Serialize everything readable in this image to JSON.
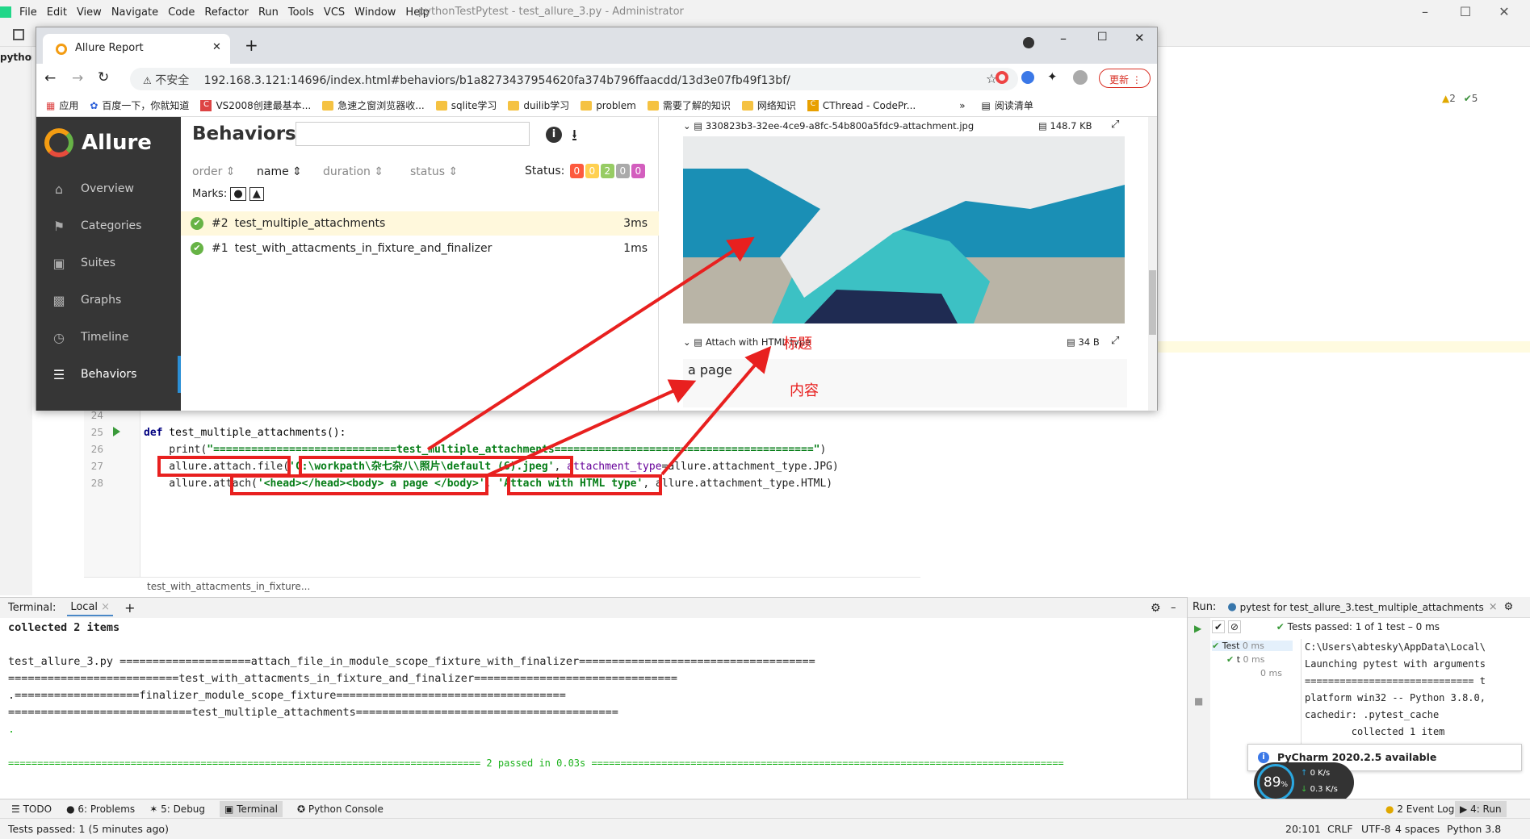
{
  "ide": {
    "menus": [
      "File",
      "Edit",
      "View",
      "Navigate",
      "Code",
      "Refactor",
      "Run",
      "Tools",
      "VCS",
      "Window",
      "Help"
    ],
    "title": "pythonTestPytest - test_allure_3.py - Administrator",
    "project_label": "pythonT",
    "inspection": {
      "warnings": "2",
      "ok": "5"
    }
  },
  "browser": {
    "tab_title": "Allure Report",
    "security": "不安全",
    "url": "192.168.3.121:14696/index.html#behaviors/b1a8273437954620fa374b796ffaacdd/13d3e07fb49f13bf/",
    "update_label": "更新",
    "bookmarks": [
      "应用",
      "百度一下，你就知道",
      "VS2008创建最基本...",
      "急速之窗浏览器收...",
      "sqlite学习",
      "duilib学习",
      "problem",
      "需要了解的知识",
      "网络知识",
      "CThread - CodePr..."
    ],
    "reading_list": "阅读清单"
  },
  "allure": {
    "brand": "Allure",
    "nav": [
      "Overview",
      "Categories",
      "Suites",
      "Graphs",
      "Timeline",
      "Behaviors"
    ],
    "page_title": "Behaviors",
    "sort": {
      "order": "order",
      "name": "name",
      "duration": "duration",
      "status": "status"
    },
    "status_label": "Status:",
    "status_counts": [
      "0",
      "0",
      "2",
      "0",
      "0"
    ],
    "marks_label": "Marks:",
    "rows": [
      {
        "num": "#2",
        "name": "test_multiple_attachments",
        "time": "3ms"
      },
      {
        "num": "#1",
        "name": "test_with_attacments_in_fixture_and_finalizer",
        "time": "1ms"
      }
    ],
    "attachments": [
      {
        "name": "330823b3-32ee-4ce9-a8fc-54b800a5fdc9-attachment.jpg",
        "size": "148.7 KB"
      },
      {
        "name": "Attach with HTML type",
        "size": "34 B",
        "content": "a page"
      }
    ]
  },
  "annotations": {
    "title": "标题",
    "content": "内容"
  },
  "code": {
    "lines": [
      "24",
      "25",
      "26",
      "27",
      "28"
    ],
    "def_kw": "def",
    "func_sig": " test_multiple_attachments():",
    "print_call": "    print(",
    "print_str": "\"=============================test_multiple_attachments=========================================\"",
    "print_end": ")",
    "l27_a": "    allure.attach.file",
    "l27_b": "(",
    "l27_path": "'C:\\workpath\\杂七杂八\\照片\\default (6).jpeg'",
    "l27_c": ", ",
    "l27_param": "attachment_type",
    "l27_d": "=allure.attachment_type.JPG)",
    "l28_a": "    allure.attach(",
    "l28_html": "'<head></head><body> a page </body>'",
    "l28_b": ", ",
    "l28_name": "'Attach with HTML type'",
    "l28_c": ", allure.attachment_type.HTML)",
    "breadcrumb": "test_with_attacments_in_fixture..."
  },
  "terminal": {
    "label": "Terminal:",
    "tab": "Local",
    "lines": [
      "collected 2 items",
      "",
      "test_allure_3.py ====================attach_file_in_module_scope_fixture_with_finalizer====================================",
      "==========================test_with_attacments_in_fixture_and_finalizer===============================",
      ".===================finalizer_module_scope_fixture===================================",
      "============================test_multiple_attachments========================================",
      ".",
      "",
      "================================================================================= 2 passed in 0.03s ================================================================================="
    ]
  },
  "run": {
    "label": "Run:",
    "config": "pytest for test_allure_3.test_multiple_attachments",
    "tests_passed": "Tests passed: 1 of 1 test – 0 ms",
    "tree": [
      {
        "name": "Test",
        "time": "0 ms"
      },
      {
        "name": "t",
        "time": "0 ms"
      },
      {
        "name": "",
        "time": "0 ms"
      }
    ],
    "output": [
      "C:\\Users\\abtesky\\AppData\\Local\\",
      "Launching pytest with arguments",
      "",
      "============================= t",
      "platform win32 -- Python 3.8.0,",
      "cachedir: .pytest_cache",
      "",
      "",
      "        collected 1 item"
    ],
    "notification": "PyCharm 2020.2.5 available",
    "cpu": "89",
    "net_up": "0 K/s",
    "net_down": "0.3 K/s"
  },
  "bottom_tabs": [
    "TODO",
    "6: Problems",
    "5: Debug",
    "Terminal",
    "Python Console"
  ],
  "bottom_right_tabs": [
    "2 Event Log",
    "4: Run"
  ],
  "status": {
    "message": "Tests passed: 1 (5 minutes ago)",
    "position": "20:101",
    "line_sep": "CRLF",
    "encoding": "UTF-8",
    "indent": "4 spaces",
    "interpreter": "Python 3.8"
  }
}
